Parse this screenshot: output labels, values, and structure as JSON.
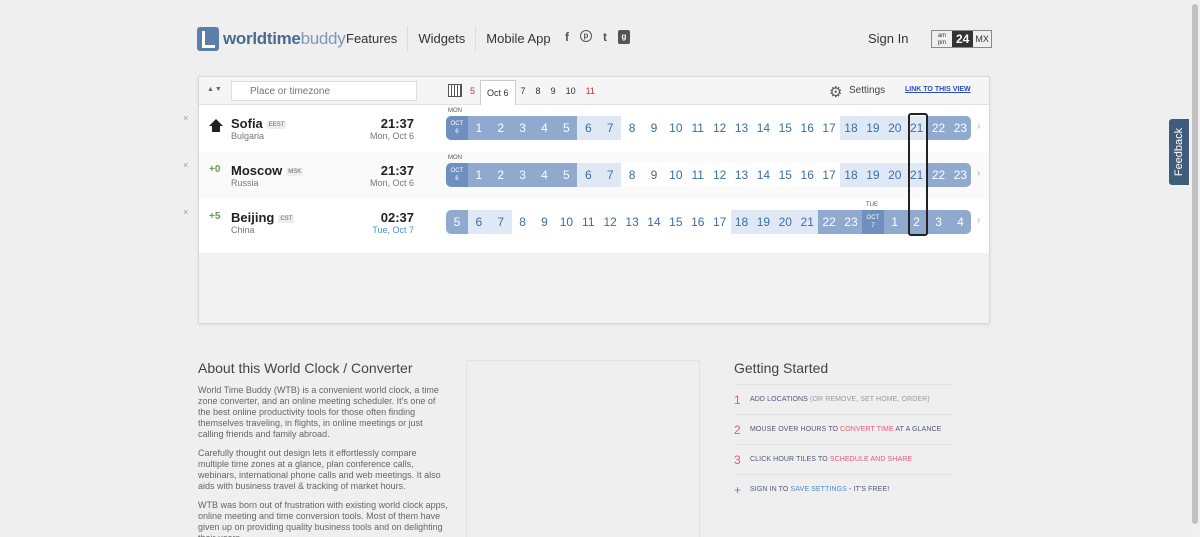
{
  "header": {
    "logo_part1": "worldtime",
    "logo_part2": "buddy",
    "nav": [
      "Features",
      "Widgets",
      "Mobile App"
    ],
    "social_icons": [
      "facebook-icon",
      "pinterest-icon",
      "twitter-icon",
      "googleplus-icon"
    ],
    "signin": "Sign In",
    "fmt_ampm": "am pm",
    "fmt_24": "24",
    "fmt_mx": "MX"
  },
  "toolbar": {
    "placeholder": "Place or timezone",
    "dates": [
      "5",
      "Oct 6",
      "7",
      "8",
      "9",
      "10",
      "11"
    ],
    "settings": "Settings",
    "link": "LINK TO THIS VIEW"
  },
  "rows": [
    {
      "city": "Sofia",
      "tz": "EEST",
      "country": "Bulgaria",
      "offset": "",
      "time": "21:37",
      "date": "Mon, Oct 6",
      "day_label": "MON",
      "tag": [
        "OCT",
        "6"
      ]
    },
    {
      "city": "Moscow",
      "tz": "MSK",
      "country": "Russia",
      "offset": "+0",
      "time": "21:37",
      "date": "Mon, Oct 6",
      "day_label": "MON",
      "tag": [
        "OCT",
        "6"
      ]
    },
    {
      "city": "Beijing",
      "tz": "CST",
      "country": "China",
      "offset": "+5",
      "time": "02:37",
      "date": "Tue, Oct 7",
      "day_label": "TUE",
      "tag": [
        "OCT",
        "7"
      ]
    }
  ],
  "hours_row1": [
    "1",
    "2",
    "3",
    "4",
    "5",
    "6",
    "7",
    "8",
    "9",
    "10",
    "11",
    "12",
    "13",
    "14",
    "15",
    "16",
    "17",
    "18",
    "19",
    "20",
    "21",
    "22",
    "23"
  ],
  "hours_row3": [
    "5",
    "6",
    "7",
    "8",
    "9",
    "10",
    "11",
    "12",
    "13",
    "14",
    "15",
    "16",
    "17",
    "18",
    "19",
    "20",
    "21",
    "22",
    "23",
    "1",
    "2",
    "3",
    "4"
  ],
  "feedback": "Feedback",
  "about": {
    "title": "About this World Clock / Converter",
    "p1": "World Time Buddy (WTB) is a convenient world clock, a time zone converter, and an online meeting scheduler. It's one of the best online productivity tools for those often finding themselves traveling, in flights, in online meetings or just calling friends and family abroad.",
    "p2": "Carefully thought out design lets it effortlessly compare multiple time zones at a glance, plan conference calls, webinars, international phone calls and web meetings. It also aids with business travel & tracking of market hours.",
    "p3": "WTB was born out of frustration with existing world clock apps, online meeting and time conversion tools. Most of them have given up on providing quality business tools and on delighting their users."
  },
  "started": {
    "title": "Getting Started",
    "steps": [
      {
        "num": "1",
        "a": "ADD LOCATIONS ",
        "b": "(OR REMOVE, SET HOME, ORDER)",
        "c": ""
      },
      {
        "num": "2",
        "a": "MOUSE OVER HOURS TO ",
        "b": "CONVERT TIME",
        "c": " AT A GLANCE"
      },
      {
        "num": "3",
        "a": "CLICK HOUR TILES TO ",
        "b": "SCHEDULE AND SHARE",
        "c": ""
      },
      {
        "num": "+",
        "a": "SIGN IN TO ",
        "b": "SAVE SETTINGS",
        "c": " - IT'S FREE!"
      }
    ]
  }
}
